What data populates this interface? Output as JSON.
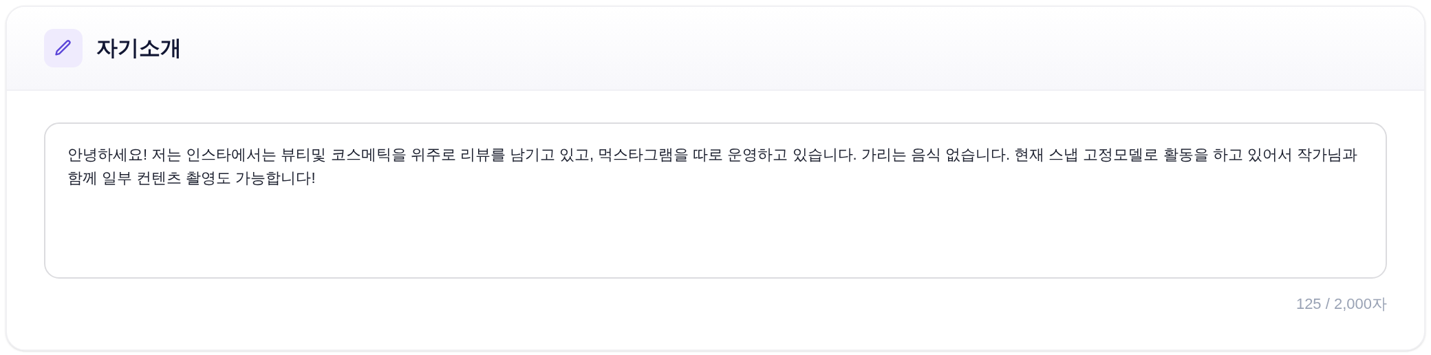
{
  "section": {
    "title": "자기소개"
  },
  "field": {
    "value": "안녕하세요! 저는 인스타에서는 뷰티및 코스메틱을 위주로 리뷰를 남기고 있고, 먹스타그램을 따로 운영하고 있습니다. 가리는 음식 없습니다. 현재 스냅 고정모델로 활동을 하고 있어서 작가님과 함께 일부 컨텐츠 촬영도 가능합니다!",
    "counter": "125 / 2,000자"
  }
}
